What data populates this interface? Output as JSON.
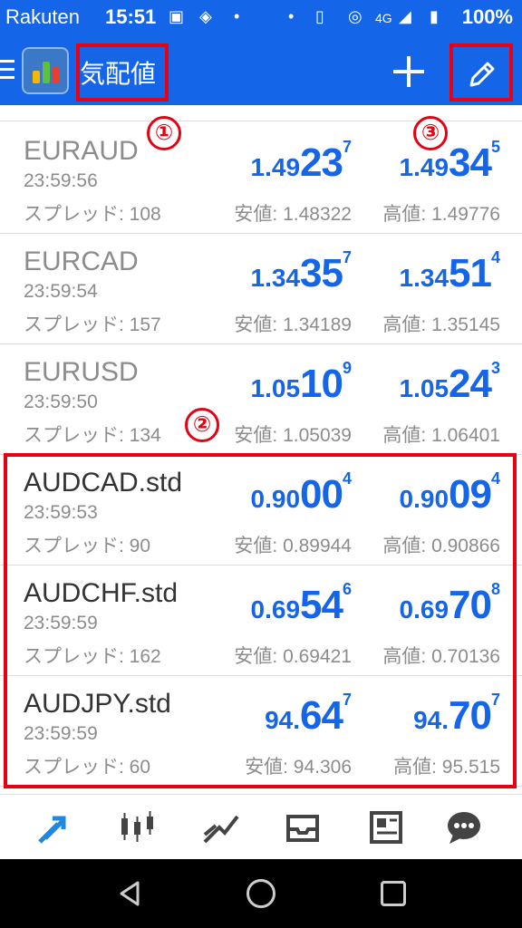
{
  "status_bar": {
    "carrier": "Rakuten",
    "time": "15:51",
    "network": "4G",
    "battery": "100%"
  },
  "app_bar": {
    "title": "気配値"
  },
  "annotations": {
    "marker_1": "①",
    "marker_2": "②",
    "marker_3": "③",
    "highlight_color": "#e60012"
  },
  "colors": {
    "accent": "#1565e8",
    "muted_text": "#8c8c8c"
  },
  "quotes": [
    {
      "symbol": "EURAUD",
      "time": "23:59:56",
      "spread": "スプレッド: 108",
      "bid": {
        "prefix": "1.49",
        "big": "23",
        "sup": "7"
      },
      "ask": {
        "prefix": "1.49",
        "big": "34",
        "sup": "5"
      },
      "low": "安値: 1.48322",
      "high": "高値: 1.49776"
    },
    {
      "symbol": "EURCAD",
      "time": "23:59:54",
      "spread": "スプレッド: 157",
      "bid": {
        "prefix": "1.34",
        "big": "35",
        "sup": "7"
      },
      "ask": {
        "prefix": "1.34",
        "big": "51",
        "sup": "4"
      },
      "low": "安値: 1.34189",
      "high": "高値: 1.35145"
    },
    {
      "symbol": "EURUSD",
      "time": "23:59:50",
      "spread": "スプレッド: 134",
      "bid": {
        "prefix": "1.05",
        "big": "10",
        "sup": "9"
      },
      "ask": {
        "prefix": "1.05",
        "big": "24",
        "sup": "3"
      },
      "low": "安値: 1.05039",
      "high": "高値: 1.06401"
    },
    {
      "symbol": "AUDCAD.std",
      "time": "23:59:53",
      "spread": "スプレッド: 90",
      "bid": {
        "prefix": "0.90",
        "big": "00",
        "sup": "4"
      },
      "ask": {
        "prefix": "0.90",
        "big": "09",
        "sup": "4"
      },
      "low": "安値: 0.89944",
      "high": "高値: 0.90866"
    },
    {
      "symbol": "AUDCHF.std",
      "time": "23:59:59",
      "spread": "スプレッド: 162",
      "bid": {
        "prefix": "0.69",
        "big": "54",
        "sup": "6"
      },
      "ask": {
        "prefix": "0.69",
        "big": "70",
        "sup": "8"
      },
      "low": "安値: 0.69421",
      "high": "高値: 0.70136"
    },
    {
      "symbol": "AUDJPY.std",
      "time": "23:59:59",
      "spread": "スプレッド: 60",
      "bid": {
        "prefix": "94.",
        "big": "64",
        "sup": "7"
      },
      "ask": {
        "prefix": "94.",
        "big": "70",
        "sup": "7"
      },
      "low": "安値: 94.306",
      "high": "高値: 95.515"
    }
  ],
  "bottom_nav": [
    "quotes-icon",
    "chart-icon",
    "trade-icon",
    "history-icon",
    "news-icon",
    "chat-icon"
  ]
}
